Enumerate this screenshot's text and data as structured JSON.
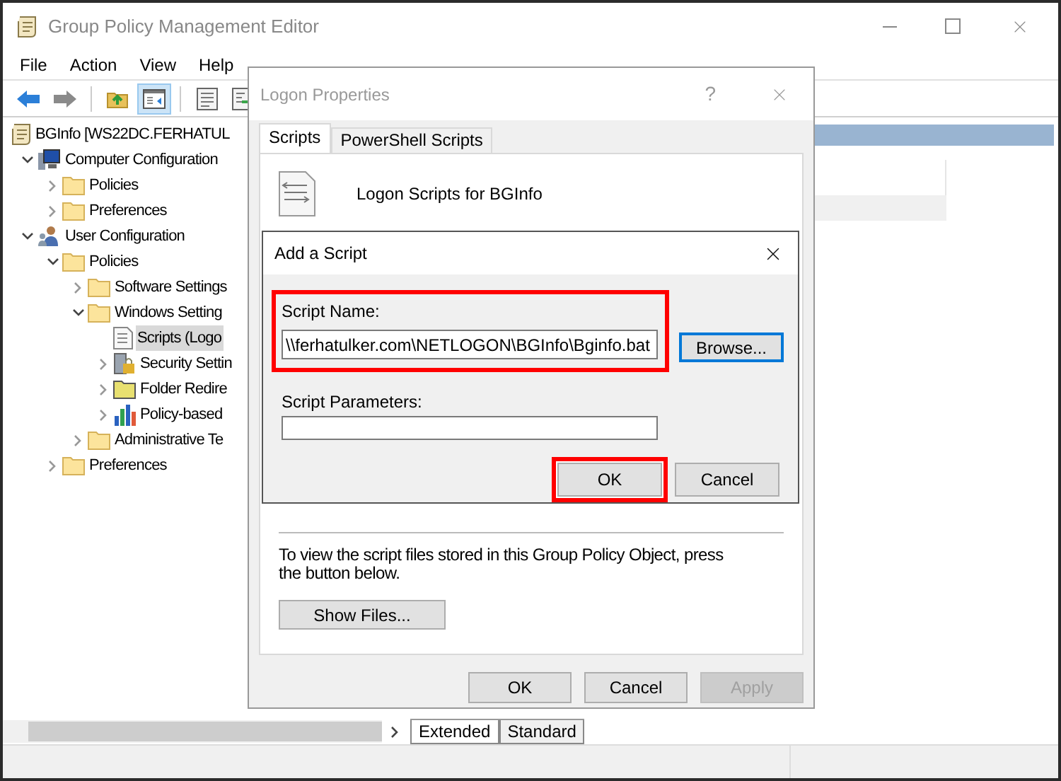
{
  "window": {
    "title": "Group Policy Management Editor"
  },
  "menu": [
    "File",
    "Action",
    "View",
    "Help"
  ],
  "toolbar": [
    {
      "kind": "back",
      "selected": false
    },
    {
      "kind": "forward",
      "selected": false
    },
    {
      "kind": "up",
      "selected": false
    },
    {
      "kind": "pane",
      "selected": true
    },
    {
      "kind": "properties",
      "selected": false
    },
    {
      "kind": "export",
      "selected": false
    }
  ],
  "tree": [
    {
      "label": "BGInfo [WS22DC.FERHATUL",
      "kind": "scroll",
      "selected": false,
      "children": [
        {
          "label": "Computer Configuration",
          "kind": "computer",
          "expanded": true,
          "selected": false,
          "children": [
            {
              "label": "Policies",
              "kind": "folder",
              "expanded": false,
              "selected": false
            },
            {
              "label": "Preferences",
              "kind": "folder",
              "expanded": false,
              "selected": false
            }
          ]
        },
        {
          "label": "User Configuration",
          "kind": "users",
          "expanded": true,
          "selected": false,
          "children": [
            {
              "label": "Policies",
              "kind": "folder",
              "expanded": true,
              "selected": false,
              "children": [
                {
                  "label": "Software Settings",
                  "kind": "folder",
                  "expanded": false,
                  "selected": false
                },
                {
                  "label": "Windows Setting",
                  "kind": "folder",
                  "expanded": true,
                  "selected": false,
                  "children": [
                    {
                      "label": "Scripts (Logo",
                      "kind": "script",
                      "selected": true
                    },
                    {
                      "label": "Security Settin",
                      "kind": "security",
                      "expanded": false,
                      "selected": false
                    },
                    {
                      "label": "Folder Redire",
                      "kind": "redirect",
                      "expanded": false,
                      "selected": false
                    },
                    {
                      "label": "Policy-based",
                      "kind": "chart",
                      "expanded": false,
                      "selected": false
                    }
                  ]
                },
                {
                  "label": "Administrative Te",
                  "kind": "folder",
                  "expanded": false,
                  "selected": false
                }
              ]
            },
            {
              "label": "Preferences",
              "kind": "folder",
              "expanded": false,
              "selected": false
            }
          ]
        }
      ]
    }
  ],
  "view_tabs": [
    {
      "label": "Extended",
      "selected": true
    },
    {
      "label": "Standard",
      "selected": false
    }
  ],
  "logon_dialog": {
    "title": "Logon Properties",
    "help": "?",
    "tabs": [
      {
        "label": "Scripts",
        "selected": true
      },
      {
        "label": "PowerShell Scripts",
        "selected": false
      }
    ],
    "heading": "Logon Scripts for BGInfo",
    "note": "To view the script files stored in this Group Policy Object, press the button below.",
    "show_files": "Show Files...",
    "buttons": [
      {
        "label": "OK",
        "disabled": false
      },
      {
        "label": "Cancel",
        "disabled": false
      },
      {
        "label": "Apply",
        "disabled": true
      }
    ]
  },
  "add_script": {
    "title": "Add a Script",
    "name_label": "Script Name:",
    "name_value": "\\\\ferhatulker.com\\NETLOGON\\BGInfo\\Bginfo.bat",
    "name_highlighted": true,
    "browse": "Browse...",
    "params_label": "Script Parameters:",
    "buttons": [
      {
        "label": "OK",
        "highlighted": true
      },
      {
        "label": "Cancel",
        "highlighted": false
      }
    ]
  }
}
